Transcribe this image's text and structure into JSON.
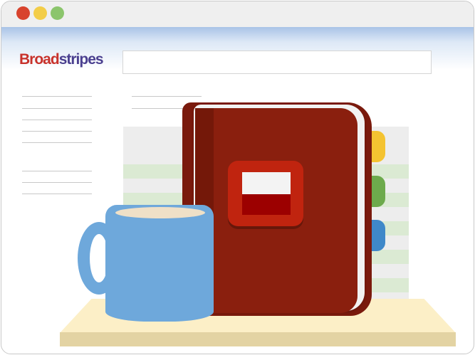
{
  "window": {
    "controls": [
      "close",
      "minimize",
      "maximize"
    ]
  },
  "header": {
    "logo_part1": "Broad",
    "logo_part2": "stripes",
    "search_placeholder": ""
  },
  "illustration": {
    "icons": [
      "book-icon",
      "coffee-mug-icon",
      "shelf-icon"
    ],
    "colors": {
      "book": "#8a1f0e",
      "mug": "#6ea8db",
      "tab_yellow": "#f4c331",
      "tab_green": "#6daa4c",
      "tab_blue": "#3f88c9",
      "shelf": "#fcefc7"
    }
  }
}
